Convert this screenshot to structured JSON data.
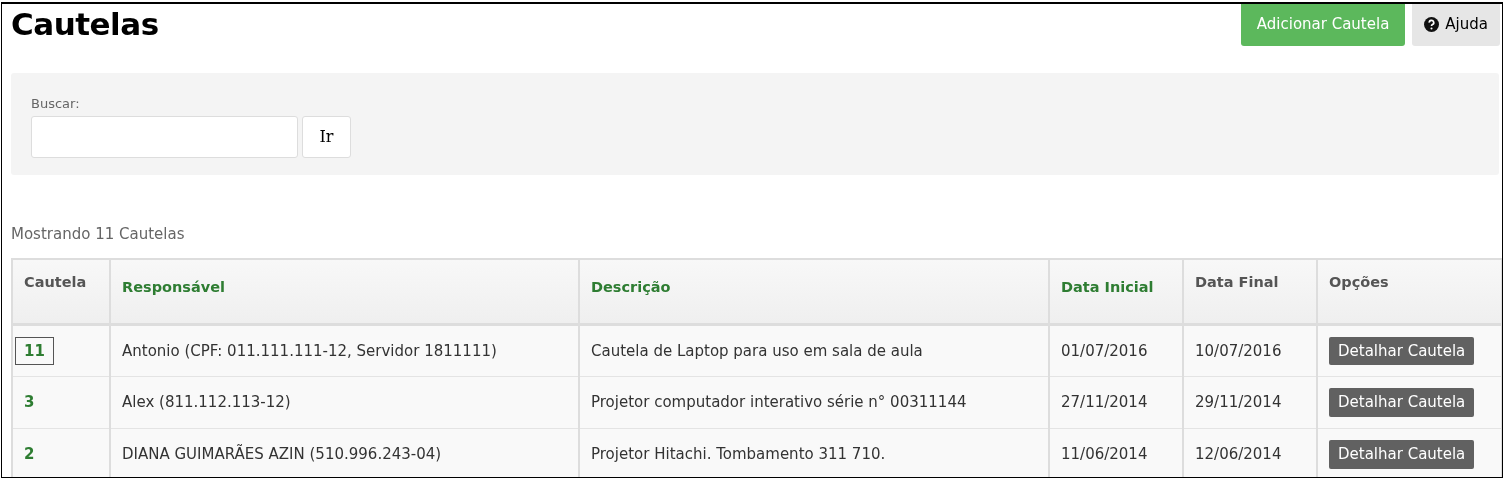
{
  "title": "Cautelas",
  "actions": [
    {
      "label": "Adicionar Cautela",
      "kind": "primary"
    },
    {
      "label": "Ajuda",
      "kind": "help"
    }
  ],
  "search": {
    "label": "Buscar:",
    "button": "Ir"
  },
  "summary": "Mostrando 11 Cautelas",
  "table": {
    "columns": [
      {
        "label": "Cautela",
        "sortable": false
      },
      {
        "label": "Responsável",
        "sortable": true
      },
      {
        "label": "Descrição",
        "sortable": true
      },
      {
        "label": "Data Inicial",
        "sortable": true
      },
      {
        "label": "Data Final",
        "sortable": false
      },
      {
        "label": "Opções",
        "sortable": false
      }
    ],
    "rows": [
      {
        "id": "11",
        "focused": true,
        "responsavel": "Antonio (CPF: 011.111.111-12, Servidor 1811111)",
        "descricao": "Cautela de Laptop para uso em sala de aula",
        "inicio": "01/07/2016",
        "fim": "10/07/2016",
        "action": "Detalhar Cautela"
      },
      {
        "id": "3",
        "focused": false,
        "responsavel": "Alex (811.112.113-12)",
        "descricao": "Projetor computador interativo série n° 00311144",
        "inicio": "27/11/2014",
        "fim": "29/11/2014",
        "action": "Detalhar Cautela"
      },
      {
        "id": "2",
        "focused": false,
        "responsavel": "DIANA GUIMARÃES AZIN (510.996.243-04)",
        "descricao": "Projetor Hitachi. Tombamento 311 710.",
        "inicio": "11/06/2014",
        "fim": "12/06/2014",
        "action": "Detalhar Cautela"
      }
    ]
  }
}
